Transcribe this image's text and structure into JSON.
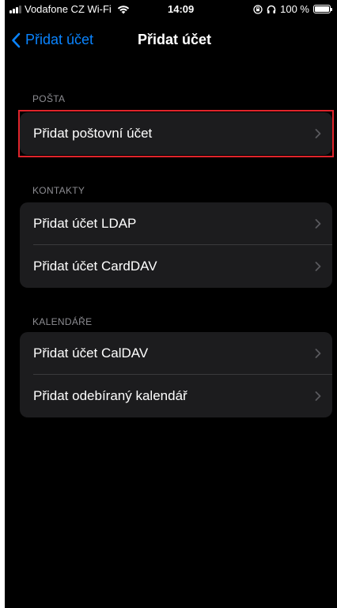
{
  "status_bar": {
    "carrier": "Vodafone CZ Wi-Fi",
    "time": "14:09",
    "battery": "100 %",
    "battery_level": 1.0,
    "icons": [
      "signal-icon",
      "wifi-icon",
      "orientation-lock-icon",
      "headphones-icon",
      "battery-icon"
    ]
  },
  "nav": {
    "back_label": "Přidat účet",
    "title": "Přidat účet"
  },
  "sections": [
    {
      "header": "POŠTA",
      "items": [
        {
          "label": "Přidat poštovní účet"
        }
      ]
    },
    {
      "header": "KONTAKTY",
      "items": [
        {
          "label": "Přidat účet LDAP"
        },
        {
          "label": "Přidat účet CardDAV"
        }
      ]
    },
    {
      "header": "KALENDÁŘE",
      "items": [
        {
          "label": "Přidat účet CalDAV"
        },
        {
          "label": "Přidat odebíraný kalendář"
        }
      ]
    }
  ],
  "colors": {
    "background": "#000000",
    "cell": "#1c1c1e",
    "accent": "#0a84ff",
    "section_header": "#8d8d92",
    "highlight": "#e0242b"
  }
}
